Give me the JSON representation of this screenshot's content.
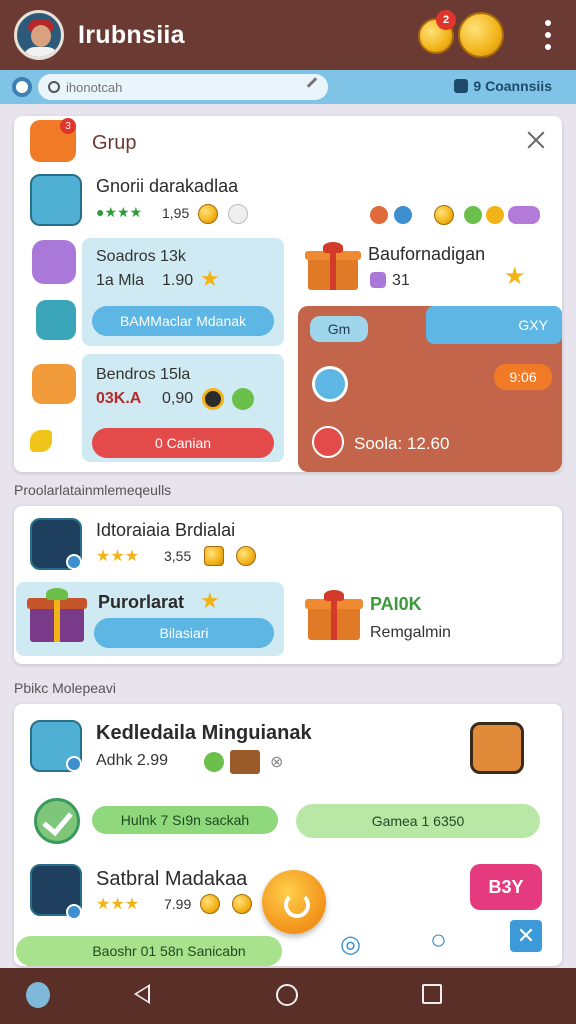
{
  "header": {
    "title": "Irubnsiia",
    "coin_badge": "2",
    "menu_icon": "more-vertical-icon"
  },
  "search": {
    "placeholder": "ihonotcah",
    "right_label": "9 Coannsiis"
  },
  "card_group": {
    "title": "Grup",
    "badge": "3",
    "player": {
      "name": "Gnorii darakadlaa",
      "rating_text": "1,95"
    },
    "left_panel_1": {
      "line1": "Soadros 13k",
      "line2": "1a Mla",
      "value": "1.90",
      "button": "BAMMaclar Mdanak"
    },
    "left_panel_2": {
      "line1": "Bendros 15la",
      "line2": "03K.A",
      "value": "0,90",
      "button": "0 Canian"
    },
    "reward": {
      "title": "Baufornadigan",
      "sub": "31"
    },
    "brown_panel": {
      "label_left": "Gm",
      "label_right": "GXY",
      "timer": "9:06",
      "score": "Soola: 12.60"
    }
  },
  "section_popular": {
    "label": "Proolarlatainmlemeqeulls"
  },
  "card_popular": {
    "player": {
      "name": "Idtoraiaia Brdialai",
      "rating_text": "3,55"
    },
    "promo": {
      "title": "Purorlarat",
      "button": "Bilasiari"
    },
    "side": {
      "title": "PAI0K",
      "sub": "Remgalmin"
    }
  },
  "section_public": {
    "label": "Pbikc Molepeavi"
  },
  "card_public": {
    "player1": {
      "name": "Kedledaila Minguianak",
      "rating_text": "Adhk 2.99"
    },
    "pill_left": "Hulnk 7 Sı9n sackah",
    "pill_right": "Gamea 1 6350",
    "player2": {
      "name": "Satbral Madakaa",
      "rating_text": "7.99"
    },
    "buy_button": "B3Y",
    "pill_bottom": "Baoshr 01 58n Sanicabn"
  },
  "colors": {
    "header_bg": "#6b3a32",
    "search_bar": "#7fc4e6",
    "primary_button": "#5db6e3",
    "danger_button": "#e34a4a",
    "accent_panel": "#c2654a",
    "buy_button": "#e63a7f"
  }
}
